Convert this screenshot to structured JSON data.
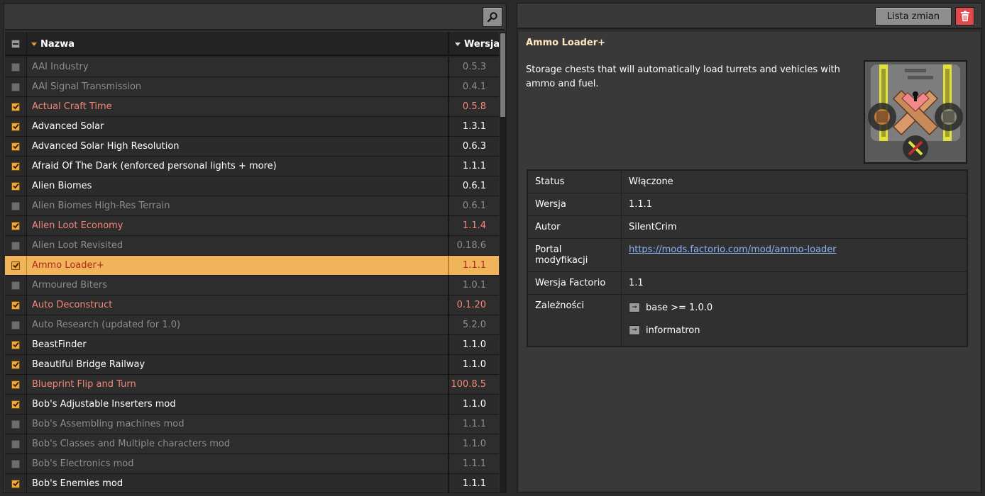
{
  "left": {
    "search_icon": "magnifier-icon",
    "header": {
      "name": "Nazwa",
      "version": "Wersja"
    },
    "mods": [
      {
        "name": "AAI Industry",
        "version": "0.5.3",
        "state": "disabled"
      },
      {
        "name": "AAI Signal Transmission",
        "version": "0.4.1",
        "state": "disabled"
      },
      {
        "name": "Actual Craft Time",
        "version": "0.5.8",
        "state": "warn"
      },
      {
        "name": "Advanced Solar",
        "version": "1.3.1",
        "state": "enabled"
      },
      {
        "name": "Advanced Solar High Resolution",
        "version": "0.6.3",
        "state": "enabled"
      },
      {
        "name": "Afraid Of The Dark (enforced personal lights + more)",
        "version": "1.1.1",
        "state": "enabled"
      },
      {
        "name": "Alien Biomes",
        "version": "0.6.1",
        "state": "enabled"
      },
      {
        "name": "Alien Biomes High-Res Terrain",
        "version": "0.6.1",
        "state": "disabled"
      },
      {
        "name": "Alien Loot Economy",
        "version": "1.1.4",
        "state": "warn"
      },
      {
        "name": "Alien Loot Revisited",
        "version": "0.18.6",
        "state": "disabled"
      },
      {
        "name": "Ammo Loader+",
        "version": "1.1.1",
        "state": "selected"
      },
      {
        "name": "Armoured Biters",
        "version": "1.0.1",
        "state": "disabled"
      },
      {
        "name": "Auto Deconstruct",
        "version": "0.1.20",
        "state": "warn"
      },
      {
        "name": "Auto Research (updated for 1.0)",
        "version": "5.2.0",
        "state": "disabled"
      },
      {
        "name": "BeastFinder",
        "version": "1.1.0",
        "state": "enabled"
      },
      {
        "name": "Beautiful Bridge Railway",
        "version": "1.1.0",
        "state": "enabled"
      },
      {
        "name": "Blueprint Flip and Turn",
        "version": "100.8.5",
        "state": "warn"
      },
      {
        "name": "Bob's Adjustable Inserters mod",
        "version": "1.1.0",
        "state": "enabled"
      },
      {
        "name": "Bob's Assembling machines mod",
        "version": "1.1.1",
        "state": "disabled"
      },
      {
        "name": "Bob's Classes and Multiple characters mod",
        "version": "1.1.0",
        "state": "disabled"
      },
      {
        "name": "Bob's Electronics mod",
        "version": "1.1.1",
        "state": "disabled"
      },
      {
        "name": "Bob's Enemies mod",
        "version": "1.1.1",
        "state": "enabled"
      }
    ]
  },
  "right": {
    "changelog_label": "Lista zmian",
    "delete_icon": "trash-icon",
    "title": "Ammo Loader+",
    "description": "Storage chests that will automatically load turrets and vehicles with ammo and fuel.",
    "info": {
      "status_key": "Status",
      "status_val": "Włączone",
      "version_key": "Wersja",
      "version_val": "1.1.1",
      "author_key": "Autor",
      "author_val": "SilentCrim",
      "portal_key": "Portal modyfikacji",
      "portal_val": "https://mods.factorio.com/mod/ammo-loader",
      "factorio_key": "Wersja Factorio",
      "factorio_val": "1.1",
      "deps_key": "Zależności",
      "deps": [
        "base >= 1.0.0",
        "informatron"
      ]
    }
  },
  "colors": {
    "selected_row": "#f0b55a",
    "warn_text": "#f4877a",
    "checkbox_on": "#f0a838",
    "delete_button": "#e04a4a",
    "link": "#8cb4f0"
  }
}
